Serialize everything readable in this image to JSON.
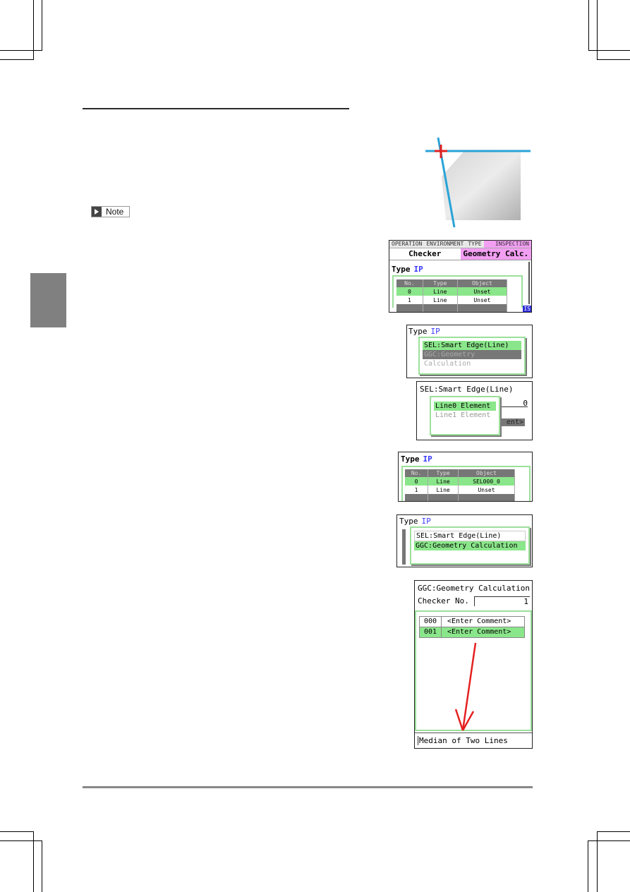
{
  "page": {
    "note_label": "Note"
  },
  "screens": {
    "menu_screen": {
      "top_tabs": [
        "OPERATION",
        "ENVIRONMENT",
        "TYPE",
        "INSPECTION"
      ],
      "active_top_tab": "INSPECTION",
      "sub_tabs": [
        "Checker",
        "Geometry Calc."
      ],
      "active_sub_tab": "Geometry Calc.",
      "type_label": "Type",
      "type_value": "IP",
      "table": {
        "headers": [
          "No.",
          "Type",
          "Object"
        ],
        "rows": [
          {
            "no": "0",
            "type": "Line",
            "object": "Unset"
          },
          {
            "no": "1",
            "type": "Line",
            "object": "Unset"
          }
        ]
      },
      "corner_badge": "IS"
    },
    "source_select_1": {
      "type_label": "Type",
      "type_value": "IP",
      "options": [
        "SEL:Smart Edge(Line)",
        "GGC:Geometry Calculation"
      ],
      "selected": "SEL:Smart Edge(Line)"
    },
    "element_select": {
      "title": "SEL:Smart Edge(Line)",
      "checker_value": "0",
      "options": [
        "Line0 Element",
        "Line1 Element"
      ],
      "selected": "Line0 Element",
      "behind_button": "ent>"
    },
    "result_table": {
      "type_label": "Type",
      "type_value": "IP",
      "table": {
        "headers": [
          "No.",
          "Type",
          "Object"
        ],
        "rows": [
          {
            "no": "0",
            "type": "Line",
            "object": "SEL000_0"
          },
          {
            "no": "1",
            "type": "Line",
            "object": "Unset"
          }
        ]
      }
    },
    "source_select_2": {
      "type_label": "Type",
      "type_value": "IP",
      "options": [
        "SEL:Smart Edge(Line)",
        "GGC:Geometry Calculation"
      ],
      "selected": "GGC:Geometry Calculation"
    },
    "ggc_select": {
      "title": "GGC:Geometry Calculation",
      "checker_label": "Checker No.",
      "checker_value": "1",
      "rows": [
        {
          "no": "000",
          "comment": "<Enter Comment>"
        },
        {
          "no": "001",
          "comment": "<Enter Comment>"
        }
      ],
      "selected_index": 1,
      "status_text": "Median of Two Lines"
    }
  },
  "colors": {
    "highlight_green": "#8ae68a",
    "tab_pink": "#f29ef2",
    "ip_blue": "#3a3aff",
    "line_blue": "#29a3d6",
    "cross_red": "#e02020"
  }
}
